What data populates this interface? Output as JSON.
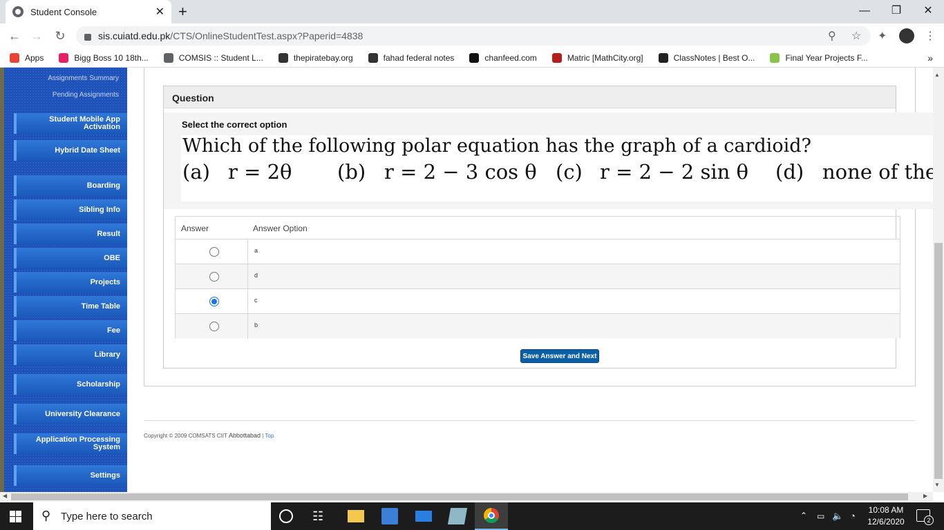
{
  "browser": {
    "tab_title": "Student Console",
    "tab_close": "✕",
    "new_tab": "+",
    "url_host": "sis.cuiatd.edu.pk",
    "url_path": "/CTS/OnlineStudentTest.aspx?Paperid=4838",
    "bookmarks": [
      {
        "label": "Apps",
        "color": "#ea4335"
      },
      {
        "label": "Bigg Boss 10 18th...",
        "color": "#e91e63"
      },
      {
        "label": "COMSIS :: Student L...",
        "color": "#5f6368"
      },
      {
        "label": "thepiratebay.org",
        "color": "#333333"
      },
      {
        "label": "fahad federal notes",
        "color": "#333333"
      },
      {
        "label": "chanfeed.com",
        "color": "#111111"
      },
      {
        "label": "Matric [MathCity.org]",
        "color": "#b71c1c"
      },
      {
        "label": "ClassNotes | Best O...",
        "color": "#222222"
      },
      {
        "label": "Final Year Projects F...",
        "color": "#8bc34a"
      }
    ],
    "bookmarks_more": "»"
  },
  "sidebar": {
    "sublinks": [
      "Assignments Summary",
      "Pending Assignments"
    ],
    "items": [
      "Student Mobile App Activation",
      "Hybrid Date Sheet",
      "Boarding",
      "Sibling Info",
      "Result",
      "OBE",
      "Projects",
      "Time Table",
      "Fee",
      "Library",
      "Scholarship",
      "University Clearance",
      "Application Processing System",
      "Settings"
    ]
  },
  "question": {
    "header": "Question",
    "instruction": "Select the correct option",
    "text": "Which of the following polar equation has the graph of a cardioid?",
    "options": [
      {
        "label": "(a)",
        "expr": "r = 2θ"
      },
      {
        "label": "(b)",
        "expr": "r = 2 − 3 cos θ"
      },
      {
        "label": "(c)",
        "expr": "r = 2 − 2 sin θ"
      },
      {
        "label": "(d)",
        "expr": "none of these"
      }
    ]
  },
  "answers": {
    "col_answer": "Answer",
    "col_option": "Answer Option",
    "rows": [
      {
        "option": "a",
        "selected": false
      },
      {
        "option": "d",
        "selected": false
      },
      {
        "option": "c",
        "selected": true
      },
      {
        "option": "b",
        "selected": false
      }
    ],
    "submit_label": "Save Answer and Next"
  },
  "footer": {
    "copyright": "Copyright © 2009 COMSATS CIIT",
    "campus": "Abbottabad",
    "separator": "|",
    "top_link": "Top"
  },
  "taskbar": {
    "search_placeholder": "Type here to search",
    "time": "10:08 AM",
    "date": "12/6/2020",
    "notifications": "2"
  }
}
